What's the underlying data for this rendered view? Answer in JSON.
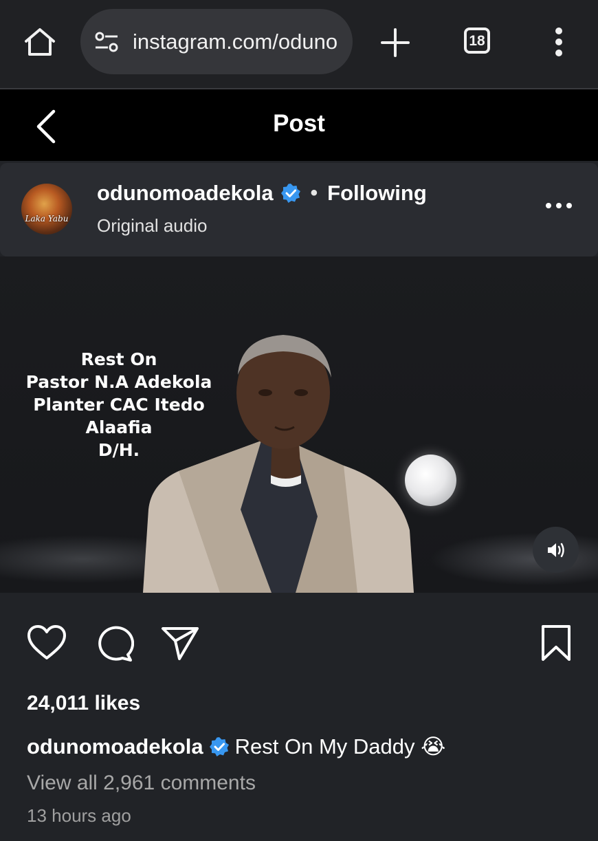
{
  "browser": {
    "url": "instagram.com/odunomoadekola",
    "tab_count": "18",
    "icons": [
      "home-icon",
      "site-settings-icon",
      "plus-icon",
      "tabs-icon",
      "kebab-menu-icon"
    ]
  },
  "header": {
    "title": "Post",
    "back_icon": "chevron-left-icon"
  },
  "author": {
    "username": "odunomoadekola",
    "verified": true,
    "separator": "•",
    "follow_status": "Following",
    "audio": "Original audio",
    "avatar_text": "Laka Yabu"
  },
  "media": {
    "overlay_text": [
      "Rest On",
      "Pastor N.A Adekola",
      "Planter CAC Itedo Alaafia",
      "D/H."
    ],
    "volume_icon": "volume-on-icon"
  },
  "actions": {
    "icons": [
      "heart-icon",
      "comment-icon",
      "share-icon",
      "bookmark-icon"
    ]
  },
  "post": {
    "likes": "24,011 likes",
    "caption_user": "odunomoadekola",
    "caption_text": "Rest On My Daddy 😭",
    "view_comments": "View all 2,961 comments",
    "timestamp": "13 hours ago"
  },
  "colors": {
    "background": "#212327",
    "header": "#000000",
    "card": "#2a2c31",
    "verified": "#3897f0",
    "muted_text": "#a8a8a8"
  }
}
